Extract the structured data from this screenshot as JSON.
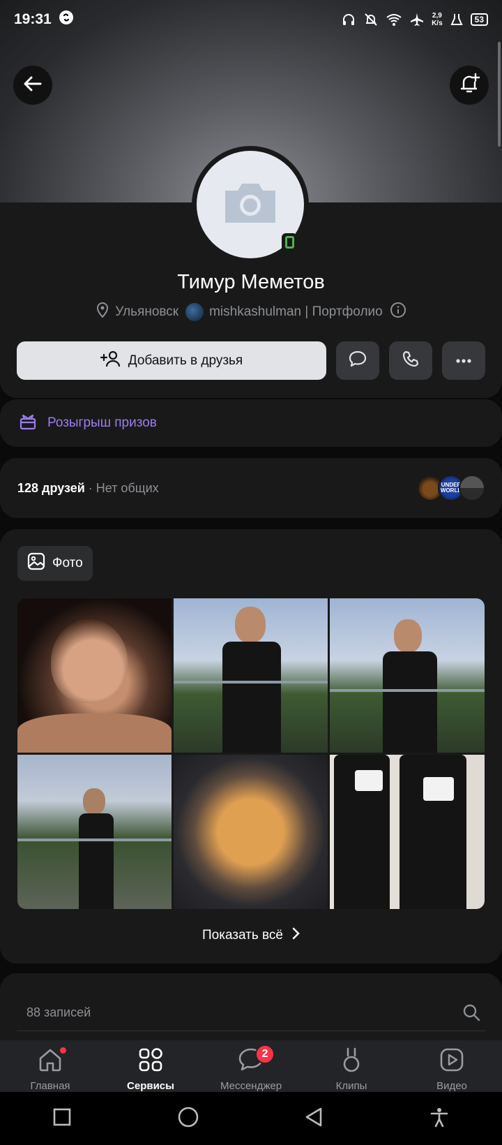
{
  "status": {
    "time": "19:31",
    "net_speed_value": "2,9",
    "net_speed_unit": "K/s",
    "battery": "53"
  },
  "profile": {
    "name": "Тимур Меметов",
    "city": "Ульяновск",
    "community": "mishkashulman | Портфолио"
  },
  "actions": {
    "add_friend_label": "Добавить в друзья"
  },
  "prize": {
    "label": "Розыгрыш призов"
  },
  "friends": {
    "count_label": "128 друзей",
    "common_label": " · Нет общих",
    "avatar_text": "UNDER WORLD"
  },
  "photos": {
    "chip_label": "Фото",
    "show_all_label": "Показать всё"
  },
  "posts": {
    "count_label": "88 записей"
  },
  "tabs": [
    {
      "label": "Главная"
    },
    {
      "label": "Сервисы"
    },
    {
      "label": "Мессенджер",
      "badge": "2"
    },
    {
      "label": "Клипы"
    },
    {
      "label": "Видео"
    }
  ],
  "colors": {
    "accent_purple": "#9b7df0",
    "badge_red": "#ff3347",
    "online_green": "#4bb34b"
  }
}
